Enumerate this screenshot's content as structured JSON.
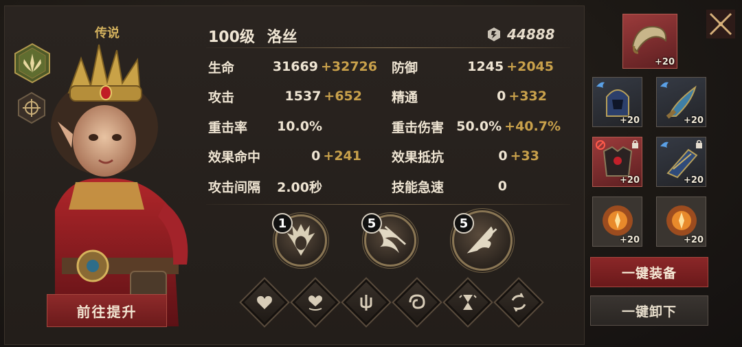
{
  "hero": {
    "rarity": "传说",
    "level": "100级",
    "name": "洛丝",
    "power": "44888"
  },
  "stats": [
    {
      "name": "生命",
      "value": "31669",
      "bonus": "+32726"
    },
    {
      "name": "防御",
      "value": "1245",
      "bonus": "+2045"
    },
    {
      "name": "攻击",
      "value": "1537",
      "bonus": "+652"
    },
    {
      "name": "精通",
      "value": "0",
      "bonus": "+332"
    },
    {
      "name": "重击率",
      "value": "10.0%",
      "bonus": ""
    },
    {
      "name": "重击伤害",
      "value": "50.0%",
      "bonus": "+40.7%"
    },
    {
      "name": "效果命中",
      "value": "0",
      "bonus": "+241"
    },
    {
      "name": "效果抵抗",
      "value": "0",
      "bonus": "+33"
    },
    {
      "name": "攻击间隔",
      "value": "2.00秒",
      "bonus": ""
    },
    {
      "name": "技能急速",
      "value": "0",
      "bonus": ""
    }
  ],
  "skills": [
    {
      "level": "1",
      "icon": "hero-face-skill-icon"
    },
    {
      "level": "5",
      "icon": "spiral-slash-skill-icon"
    },
    {
      "level": "5",
      "icon": "feather-strike-skill-icon"
    }
  ],
  "runes": [
    {
      "icon": "heart-icon"
    },
    {
      "icon": "heart-shield-icon"
    },
    {
      "icon": "trident-icon"
    },
    {
      "icon": "swirl-icon"
    },
    {
      "icon": "hourglass-icon"
    },
    {
      "icon": "circular-arrows-icon"
    }
  ],
  "equipment": {
    "horn": {
      "level": "+20"
    },
    "helmet": {
      "level": "+20"
    },
    "dagger": {
      "level": "+20"
    },
    "armor": {
      "level": "+20"
    },
    "gauntlet": {
      "level": "+20"
    },
    "gem1": {
      "level": "+20"
    },
    "gem2": {
      "level": "+20"
    }
  },
  "buttons": {
    "upgrade": "前往提升",
    "equip_all": "一键装备",
    "unequip_all": "一键卸下"
  },
  "colors": {
    "bonus": "#c9a14b",
    "accent_red": "#8b2728",
    "gold": "#d4b25e"
  }
}
